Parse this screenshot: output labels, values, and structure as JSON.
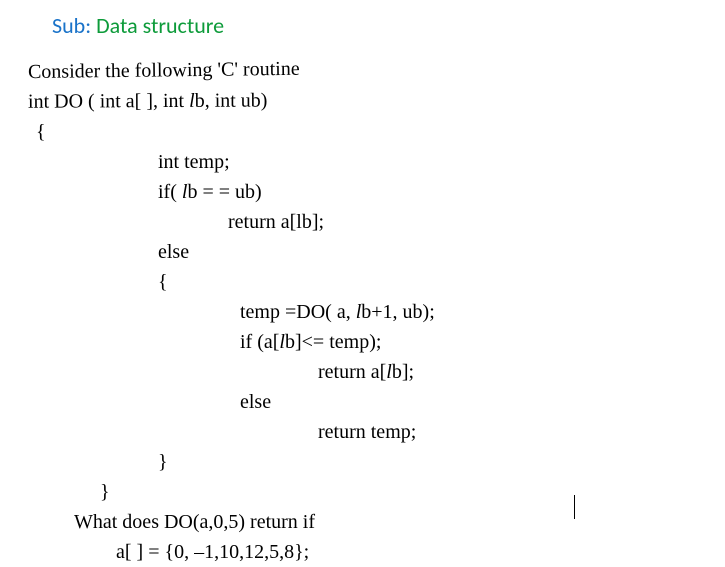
{
  "header": {
    "sub_label": "Sub:",
    "sub_value": "Data structure"
  },
  "content": {
    "intro": "Consider the following 'C' routine",
    "signature": "int DO ( int a[ ], int lb, int ub)",
    "brace_open": "{",
    "decl": "int temp;",
    "if_cond": "if( lb = = ub)",
    "return1": "return a[lb];",
    "else1": "else",
    "brace_open2": "{",
    "temp_assign": "temp =DO( a, lb+1, ub);",
    "if_cond2": "if (a[lb]<= temp);",
    "return2": "return a[lb];",
    "else2": "else",
    "return3": "return temp;",
    "brace_close2": "}",
    "brace_close": "}",
    "question": "What does DO(a,0,5) return if",
    "array": "a[ ] = {0, –1,10,12,5,8};"
  }
}
